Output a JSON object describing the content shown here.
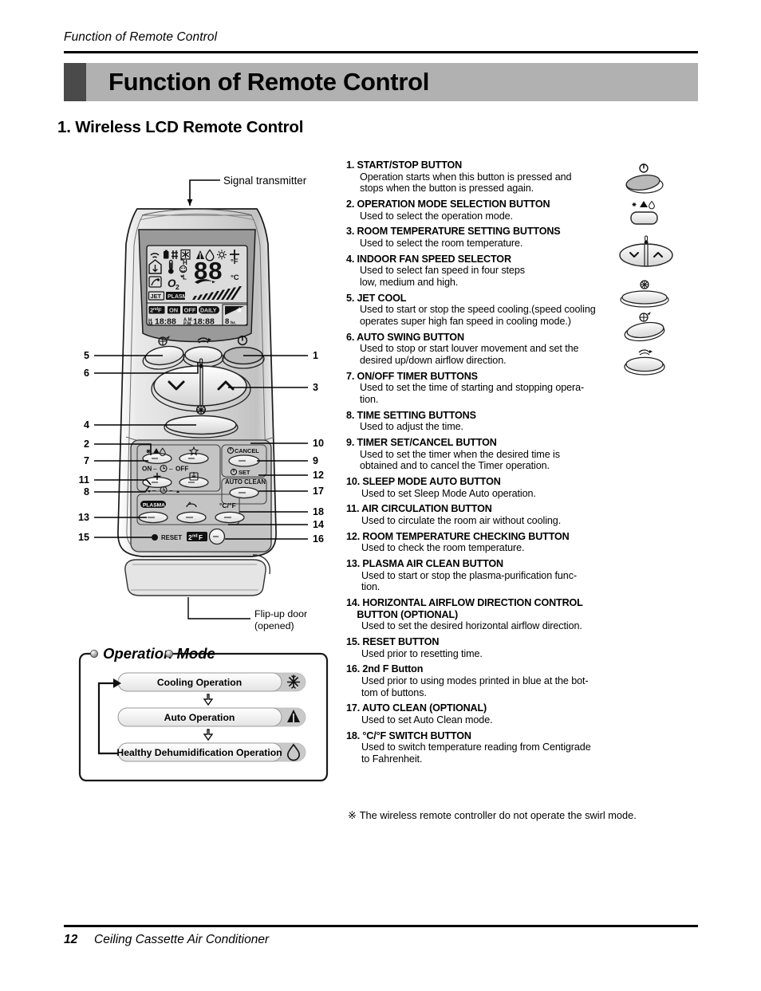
{
  "running_head": "Function of Remote Control",
  "title": "Function of Remote Control",
  "section_heading": "1. Wireless LCD Remote Control",
  "diagram": {
    "signal_transmitter_label": "Signal transmitter",
    "flip_up_door_label_line1": "Flip-up door",
    "flip_up_door_label_line2": "(opened)",
    "callouts_left": [
      "5",
      "6",
      "4",
      "2",
      "7",
      "11",
      "8",
      "13",
      "15"
    ],
    "callouts_right": [
      "1",
      "3",
      "10",
      "9",
      "12",
      "17",
      "18",
      "14",
      "16"
    ],
    "lcd": {
      "digits": "88",
      "unit_f": "°F",
      "unit_c": "°C",
      "fan_high": "H",
      "fan_low": "L",
      "o2": "O",
      "o2_sub": "2",
      "jet": "JET",
      "plasma": "PLASMA",
      "secondf": "2",
      "secondf_sup": "nd",
      "secondf_f": "F",
      "on": "ON",
      "off": "OFF",
      "daily": "DAILY",
      "time_on": "18:88",
      "time_off": "18:88",
      "sleep_hours": "8",
      "sleep_unit": "hr."
    },
    "keypad": {
      "timer_on": "ON",
      "timer_dash1": "–",
      "timer_off": "OFF",
      "timer_dash2": "–",
      "cancel": "CANCEL",
      "set": "SET",
      "auto_clean": "AUTO CLEAN",
      "down_arrow": "▼",
      "up_arrow": "▲",
      "plasma": "PLASMA",
      "cf": "°C/°F",
      "reset": "RESET",
      "secondf": "2",
      "secondf_sup": "nd",
      "secondf_f": "F"
    }
  },
  "operation_mode": {
    "title": "Operation Mode",
    "steps": [
      {
        "label": "Cooling Operation",
        "icon": "snowflake-icon"
      },
      {
        "label": "Auto Operation",
        "icon": "auto-mode-icon"
      },
      {
        "label": "Healthy Dehumidification Operation",
        "icon": "water-drop-icon"
      }
    ]
  },
  "items": [
    {
      "num": "1.",
      "title": "START/STOP BUTTON",
      "body": [
        "Operation starts when this button is pressed and",
        "stops when the button is pressed again."
      ]
    },
    {
      "num": "2.",
      "title": "OPERATION MODE SELECTION BUTTON",
      "body": [
        "Used to select the operation mode."
      ]
    },
    {
      "num": "3.",
      "title": "ROOM TEMPERATURE SETTING BUTTONS",
      "body": [
        "Used to select the room temperature."
      ]
    },
    {
      "num": "4.",
      "title": "INDOOR FAN SPEED SELECTOR",
      "body": [
        "Used to select fan speed in four steps",
        "low, medium and high."
      ]
    },
    {
      "num": "5.",
      "title": "JET COOL",
      "body": [
        "Used to start or stop the speed cooling.(speed cooling",
        "operates super high fan speed in cooling mode.)"
      ]
    },
    {
      "num": "6.",
      "title": "AUTO SWING BUTTON",
      "body": [
        "Used to stop or start louver movement and set the",
        "desired up/down airflow direction."
      ]
    },
    {
      "num": "7.",
      "title": "ON/OFF TIMER BUTTONS",
      "body": [
        "Used to set the time of starting and stopping opera-",
        "tion."
      ]
    },
    {
      "num": "8.",
      "title": "TIME SETTING BUTTONS",
      "body": [
        "Used to adjust the time."
      ]
    },
    {
      "num": "9.",
      "title": "TIMER SET/CANCEL BUTTON",
      "body": [
        "Used to set the timer when the desired time is",
        "obtained and to cancel the Timer operation."
      ]
    },
    {
      "num": "10.",
      "title": "SLEEP MODE AUTO BUTTON",
      "body": [
        "Used to set Sleep Mode Auto operation."
      ]
    },
    {
      "num": "11.",
      "title": "AIR CIRCULATION BUTTON",
      "body": [
        "Used to circulate the room air without cooling."
      ]
    },
    {
      "num": "12.",
      "title": "ROOM TEMPERATURE CHECKING BUTTON",
      "body": [
        "Used to check the room temperature."
      ]
    },
    {
      "num": "13.",
      "title": "PLASMA AIR CLEAN BUTTON",
      "body": [
        "Used to start or stop the plasma-purification func-",
        "tion."
      ]
    },
    {
      "num": "14.",
      "title": "HORIZONTAL AIRFLOW DIRECTION CONTROL\nBUTTON (OPTIONAL)",
      "body": [
        "Used to set the desired horizontal airflow direction."
      ]
    },
    {
      "num": "15.",
      "title": "RESET BUTTON",
      "body": [
        "Used prior to resetting time."
      ]
    },
    {
      "num": "16.",
      "title": "2nd F Button",
      "body": [
        "Used prior to using modes printed in blue at the bot-",
        "tom of buttons."
      ]
    },
    {
      "num": "17.",
      "title": "AUTO CLEAN (OPTIONAL)",
      "body": [
        "Used to set Auto Clean mode."
      ]
    },
    {
      "num": "18.",
      "title": "°C/°F SWITCH BUTTON",
      "body": [
        "Used to switch temperature reading from Centigrade",
        "to Fahrenheit."
      ]
    }
  ],
  "footnote": {
    "marker": "※",
    "text": "The wireless remote controller do not operate the swirl mode."
  },
  "footer": {
    "page_number": "12",
    "document_title": "Ceiling Cassette Air Conditioner"
  },
  "colors": {
    "title_bar": "#b1b1b1",
    "title_block": "#4a4a4a",
    "lcd_body": "#9a9a9a",
    "remote_body": "#d8d8d8"
  }
}
